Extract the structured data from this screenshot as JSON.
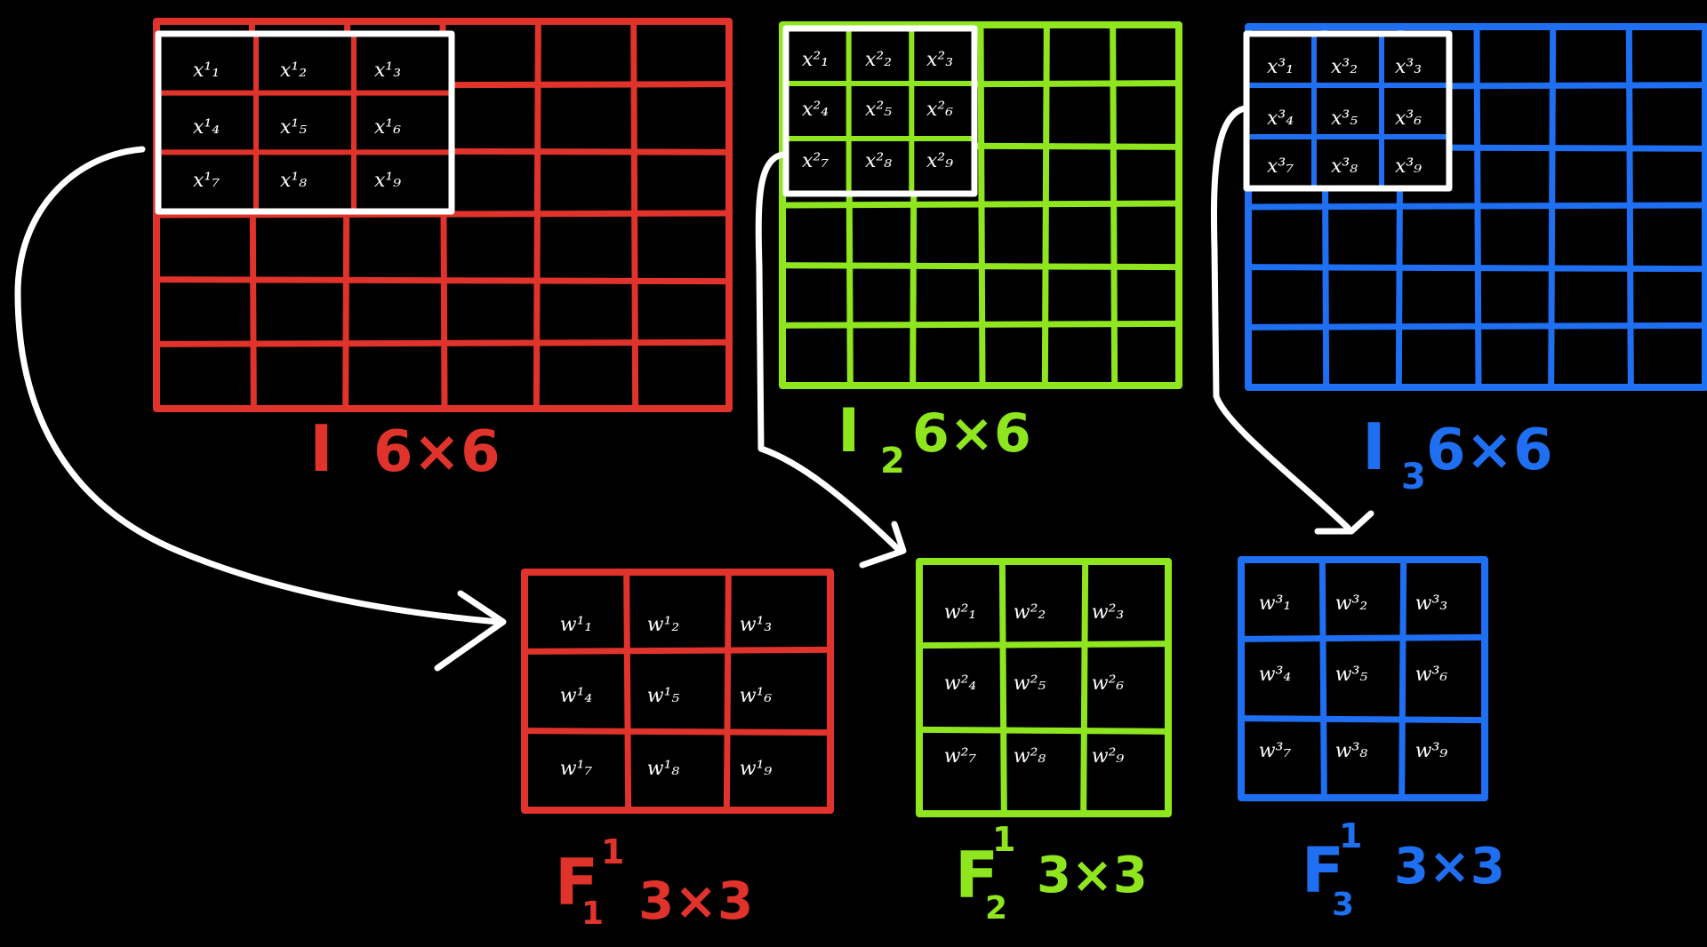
{
  "colors": {
    "background": "#000000",
    "red": "#e0332b",
    "green": "#8fe61f",
    "blue": "#1f6ff2",
    "white": "#ffffff"
  },
  "inputs": [
    {
      "id": "input-1",
      "color_key": "red",
      "rows": 6,
      "cols": 6,
      "label": {
        "main": "I",
        "sub": "",
        "dims": "6×6"
      },
      "patch_cells": [
        [
          "x¹₁",
          "x¹₂",
          "x¹₃"
        ],
        [
          "x¹₄",
          "x¹₅",
          "x¹₆"
        ],
        [
          "x¹₇",
          "x¹₈",
          "x¹₉"
        ]
      ]
    },
    {
      "id": "input-2",
      "color_key": "green",
      "rows": 6,
      "cols": 6,
      "label": {
        "main": "I",
        "sub": "2",
        "dims": "6×6"
      },
      "patch_cells": [
        [
          "x²₁",
          "x²₂",
          "x²₃"
        ],
        [
          "x²₄",
          "x²₅",
          "x²₆"
        ],
        [
          "x²₇",
          "x²₈",
          "x²₉"
        ]
      ]
    },
    {
      "id": "input-3",
      "color_key": "blue",
      "rows": 6,
      "cols": 6,
      "label": {
        "main": "I",
        "sub": "3",
        "dims": "6×6"
      },
      "patch_cells": [
        [
          "x³₁",
          "x³₂",
          "x³₃"
        ],
        [
          "x³₄",
          "x³₅",
          "x³₆"
        ],
        [
          "x³₇",
          "x³₈",
          "x³₉"
        ]
      ]
    }
  ],
  "filters": [
    {
      "id": "filter-1",
      "color_key": "red",
      "label": {
        "main": "F",
        "sup": "1",
        "sub": "1",
        "dims": "3×3"
      },
      "cells": [
        [
          "w¹₁",
          "w¹₂",
          "w¹₃"
        ],
        [
          "w¹₄",
          "w¹₅",
          "w¹₆"
        ],
        [
          "w¹₇",
          "w¹₈",
          "w¹₉"
        ]
      ]
    },
    {
      "id": "filter-2",
      "color_key": "green",
      "label": {
        "main": "F",
        "sup": "1",
        "sub": "2",
        "dims": "3×3"
      },
      "cells": [
        [
          "w²₁",
          "w²₂",
          "w²₃"
        ],
        [
          "w²₄",
          "w²₅",
          "w²₆"
        ],
        [
          "w²₇",
          "w²₈",
          "w²₉"
        ]
      ]
    },
    {
      "id": "filter-3",
      "color_key": "blue",
      "label": {
        "main": "F",
        "sup": "1",
        "sub": "3",
        "dims": "3×3"
      },
      "cells": [
        [
          "w³₁",
          "w³₂",
          "w³₃"
        ],
        [
          "w³₄",
          "w³₅",
          "w³₆"
        ],
        [
          "w³₇",
          "w³₈",
          "w³₉"
        ]
      ]
    }
  ]
}
